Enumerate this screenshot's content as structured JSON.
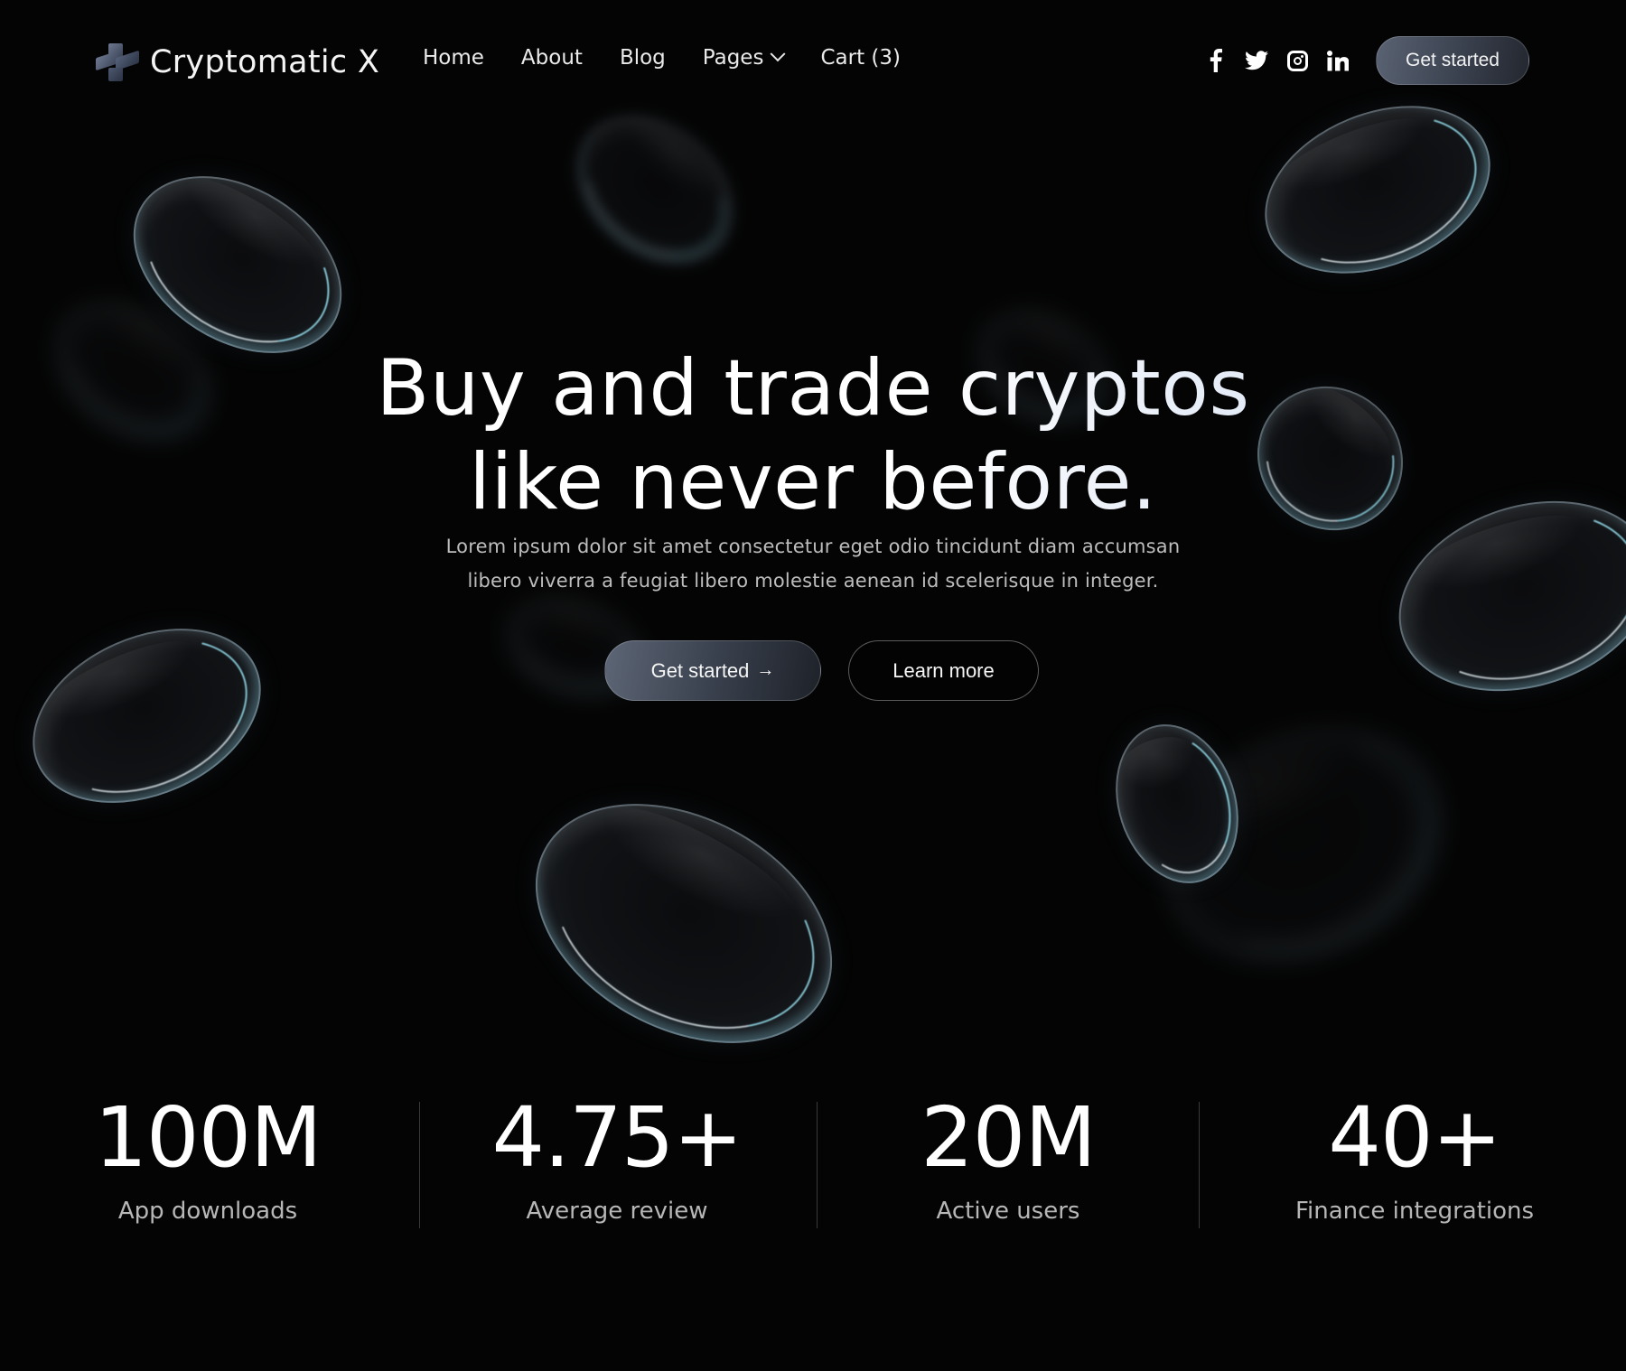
{
  "brand": {
    "name": "Cryptomatic X",
    "logo_icon": "cube-cross-logo-icon"
  },
  "nav": {
    "links": [
      {
        "label": "Home"
      },
      {
        "label": "About"
      },
      {
        "label": "Blog"
      },
      {
        "label": "Pages",
        "icon": "chevron-down-icon"
      },
      {
        "label": "Cart (3)"
      }
    ],
    "socials": [
      {
        "name": "facebook-icon",
        "glyph": "f"
      },
      {
        "name": "twitter-icon",
        "glyph": ""
      },
      {
        "name": "instagram-icon",
        "glyph": ""
      },
      {
        "name": "linkedin-icon",
        "glyph": "in"
      }
    ],
    "cta_label": "Get started"
  },
  "hero": {
    "title_line1": "Buy and trade cryptos",
    "title_line2": "like never before.",
    "subtitle_line1": "Lorem ipsum dolor sit amet consectetur eget odio tincidunt diam accumsan",
    "subtitle_line2": "libero viverra a feugiat libero molestie aenean id scelerisque in integer.",
    "primary_label": "Get started",
    "primary_arrow": "→",
    "secondary_label": "Learn more"
  },
  "stats": [
    {
      "value": "100M",
      "label": "App downloads"
    },
    {
      "value": "4.75+",
      "label": "Average review"
    },
    {
      "value": "20M",
      "label": "Active users"
    },
    {
      "value": "40+",
      "label": "Finance integrations"
    }
  ],
  "colors": {
    "background": "#040404",
    "button_gradient_start": "#5d6676",
    "button_gradient_end": "#1e2229",
    "accent_highlight": "#96e1f0"
  }
}
